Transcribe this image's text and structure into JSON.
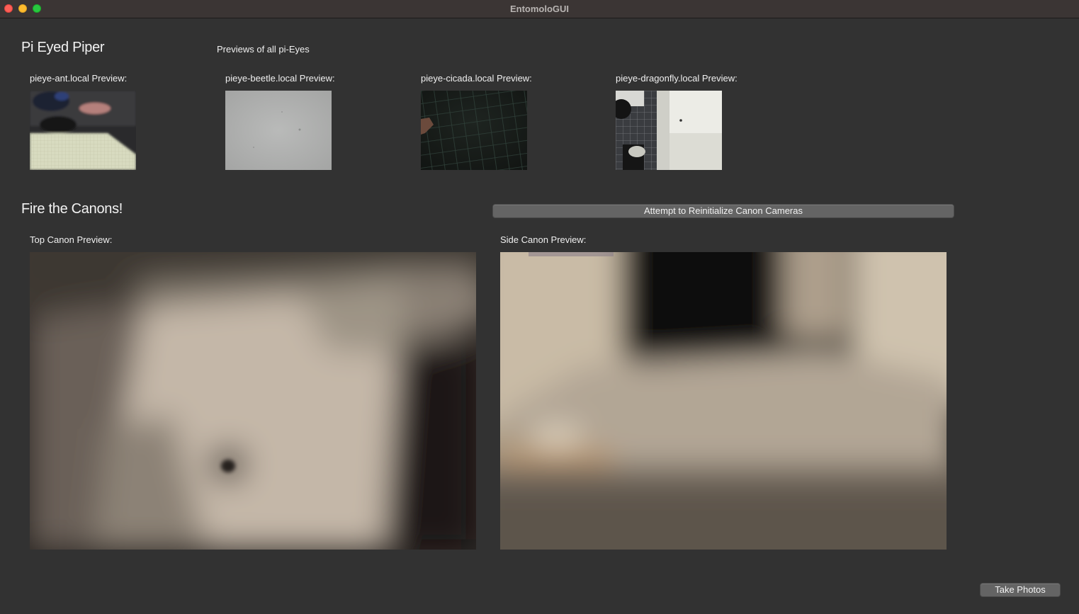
{
  "window": {
    "title": "EntomoloGUI"
  },
  "pi_section": {
    "title": "Pi Eyed Piper",
    "subtitle": "Previews of all pi-Eyes",
    "previews": [
      {
        "label": "pieye-ant.local Preview:"
      },
      {
        "label": "pieye-beetle.local Preview:"
      },
      {
        "label": "pieye-cicada.local Preview:"
      },
      {
        "label": "pieye-dragonfly.local Preview:"
      }
    ]
  },
  "canon_section": {
    "title": "Fire the Canons!",
    "reinit_button": "Attempt to Reinitialize Canon Cameras",
    "top_label": "Top Canon Preview:",
    "side_label": "Side Canon Preview:"
  },
  "take_photos_button": "Take Photos",
  "colors": {
    "background": "#323232",
    "titlebar": "#3b3534",
    "button": "#646464",
    "close": "#fe5f57",
    "minimize": "#febc2e",
    "maximize": "#28c840"
  }
}
